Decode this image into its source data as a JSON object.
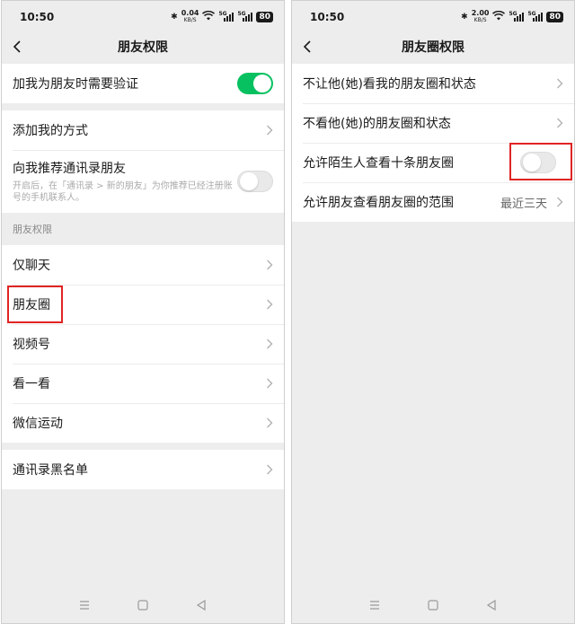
{
  "left": {
    "status": {
      "time": "10:50",
      "speed": "0.04",
      "speed_unit": "KB/S",
      "signal1": "5G",
      "signal2": "5G",
      "battery": "80"
    },
    "title": "朋友权限",
    "verify_label": "加我为朋友时需要验证",
    "add_way_label": "添加我的方式",
    "recommend_label": "向我推荐通讯录朋友",
    "recommend_desc": "开启后，在「通讯录 > 新的朋友」为你推荐已经注册账号的手机联系人。",
    "section_label": "朋友权限",
    "items": [
      "仅聊天",
      "朋友圈",
      "视频号",
      "看一看",
      "微信运动"
    ],
    "blacklist_label": "通讯录黑名单",
    "toggles": {
      "verify": true,
      "recommend": false
    }
  },
  "right": {
    "status": {
      "time": "10:50",
      "speed": "2.00",
      "speed_unit": "KB/S",
      "signal1": "5G",
      "signal2": "5G",
      "battery": "80"
    },
    "title": "朋友圈权限",
    "items": [
      "不让他(她)看我的朋友圈和状态",
      "不看他(她)的朋友圈和状态",
      "允许陌生人查看十条朋友圈",
      "允许朋友查看朋友圈的范围"
    ],
    "range_value": "最近三天",
    "toggles": {
      "stranger_ten": false
    }
  },
  "colors": {
    "accent": "#07c160",
    "highlight": "#e02424",
    "bg": "#ededed"
  }
}
